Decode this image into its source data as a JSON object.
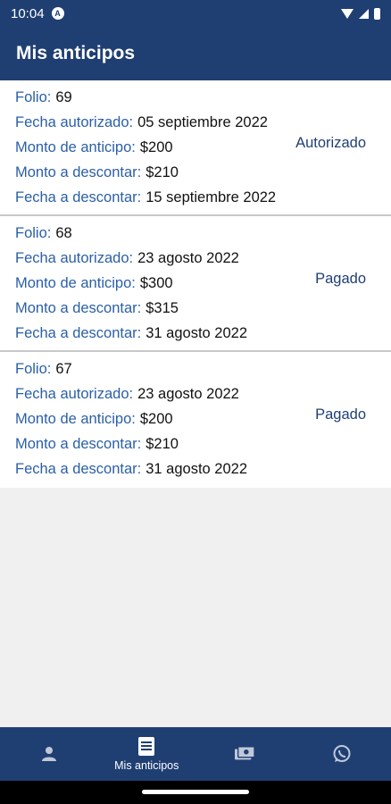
{
  "status_bar": {
    "time": "10:04",
    "app_badge": "A"
  },
  "app_bar": {
    "title": "Mis anticipos"
  },
  "labels": {
    "folio": "Folio:",
    "fecha_autorizado": "Fecha autorizado:",
    "monto_anticipo": "Monto de anticipo:",
    "monto_descontar": "Monto a descontar:",
    "fecha_descontar": "Fecha a descontar:"
  },
  "anticipos": [
    {
      "folio": "69",
      "fecha_autorizado": "05 septiembre 2022",
      "monto_anticipo": "$200",
      "monto_descontar": "$210",
      "fecha_descontar": "15 septiembre 2022",
      "status": "Autorizado"
    },
    {
      "folio": "68",
      "fecha_autorizado": "23 agosto 2022",
      "monto_anticipo": "$300",
      "monto_descontar": "$315",
      "fecha_descontar": "31 agosto 2022",
      "status": "Pagado"
    },
    {
      "folio": "67",
      "fecha_autorizado": "23 agosto 2022",
      "monto_anticipo": "$200",
      "monto_descontar": "$210",
      "fecha_descontar": "31 agosto 2022",
      "status": "Pagado"
    }
  ],
  "bottom_nav": {
    "items": [
      {
        "icon": "person-icon",
        "label": ""
      },
      {
        "icon": "document-icon",
        "label": "Mis anticipos"
      },
      {
        "icon": "money-icon",
        "label": ""
      },
      {
        "icon": "whatsapp-icon",
        "label": ""
      }
    ]
  },
  "colors": {
    "primary": "#1f3f73",
    "label_blue": "#2a5fa8",
    "background": "#f0f0f0"
  }
}
